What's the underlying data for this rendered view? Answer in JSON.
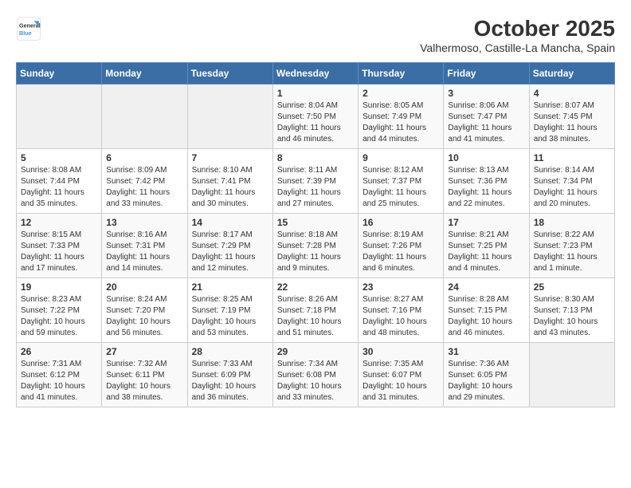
{
  "header": {
    "logo": {
      "general": "General",
      "blue": "Blue"
    },
    "title": "October 2025",
    "subtitle": "Valhermoso, Castille-La Mancha, Spain"
  },
  "weekdays": [
    "Sunday",
    "Monday",
    "Tuesday",
    "Wednesday",
    "Thursday",
    "Friday",
    "Saturday"
  ],
  "weeks": [
    [
      {
        "day": "",
        "info": ""
      },
      {
        "day": "",
        "info": ""
      },
      {
        "day": "",
        "info": ""
      },
      {
        "day": "1",
        "info": "Sunrise: 8:04 AM\nSunset: 7:50 PM\nDaylight: 11 hours and 46 minutes."
      },
      {
        "day": "2",
        "info": "Sunrise: 8:05 AM\nSunset: 7:49 PM\nDaylight: 11 hours and 44 minutes."
      },
      {
        "day": "3",
        "info": "Sunrise: 8:06 AM\nSunset: 7:47 PM\nDaylight: 11 hours and 41 minutes."
      },
      {
        "day": "4",
        "info": "Sunrise: 8:07 AM\nSunset: 7:45 PM\nDaylight: 11 hours and 38 minutes."
      }
    ],
    [
      {
        "day": "5",
        "info": "Sunrise: 8:08 AM\nSunset: 7:44 PM\nDaylight: 11 hours and 35 minutes."
      },
      {
        "day": "6",
        "info": "Sunrise: 8:09 AM\nSunset: 7:42 PM\nDaylight: 11 hours and 33 minutes."
      },
      {
        "day": "7",
        "info": "Sunrise: 8:10 AM\nSunset: 7:41 PM\nDaylight: 11 hours and 30 minutes."
      },
      {
        "day": "8",
        "info": "Sunrise: 8:11 AM\nSunset: 7:39 PM\nDaylight: 11 hours and 27 minutes."
      },
      {
        "day": "9",
        "info": "Sunrise: 8:12 AM\nSunset: 7:37 PM\nDaylight: 11 hours and 25 minutes."
      },
      {
        "day": "10",
        "info": "Sunrise: 8:13 AM\nSunset: 7:36 PM\nDaylight: 11 hours and 22 minutes."
      },
      {
        "day": "11",
        "info": "Sunrise: 8:14 AM\nSunset: 7:34 PM\nDaylight: 11 hours and 20 minutes."
      }
    ],
    [
      {
        "day": "12",
        "info": "Sunrise: 8:15 AM\nSunset: 7:33 PM\nDaylight: 11 hours and 17 minutes."
      },
      {
        "day": "13",
        "info": "Sunrise: 8:16 AM\nSunset: 7:31 PM\nDaylight: 11 hours and 14 minutes."
      },
      {
        "day": "14",
        "info": "Sunrise: 8:17 AM\nSunset: 7:29 PM\nDaylight: 11 hours and 12 minutes."
      },
      {
        "day": "15",
        "info": "Sunrise: 8:18 AM\nSunset: 7:28 PM\nDaylight: 11 hours and 9 minutes."
      },
      {
        "day": "16",
        "info": "Sunrise: 8:19 AM\nSunset: 7:26 PM\nDaylight: 11 hours and 6 minutes."
      },
      {
        "day": "17",
        "info": "Sunrise: 8:21 AM\nSunset: 7:25 PM\nDaylight: 11 hours and 4 minutes."
      },
      {
        "day": "18",
        "info": "Sunrise: 8:22 AM\nSunset: 7:23 PM\nDaylight: 11 hours and 1 minute."
      }
    ],
    [
      {
        "day": "19",
        "info": "Sunrise: 8:23 AM\nSunset: 7:22 PM\nDaylight: 10 hours and 59 minutes."
      },
      {
        "day": "20",
        "info": "Sunrise: 8:24 AM\nSunset: 7:20 PM\nDaylight: 10 hours and 56 minutes."
      },
      {
        "day": "21",
        "info": "Sunrise: 8:25 AM\nSunset: 7:19 PM\nDaylight: 10 hours and 53 minutes."
      },
      {
        "day": "22",
        "info": "Sunrise: 8:26 AM\nSunset: 7:18 PM\nDaylight: 10 hours and 51 minutes."
      },
      {
        "day": "23",
        "info": "Sunrise: 8:27 AM\nSunset: 7:16 PM\nDaylight: 10 hours and 48 minutes."
      },
      {
        "day": "24",
        "info": "Sunrise: 8:28 AM\nSunset: 7:15 PM\nDaylight: 10 hours and 46 minutes."
      },
      {
        "day": "25",
        "info": "Sunrise: 8:30 AM\nSunset: 7:13 PM\nDaylight: 10 hours and 43 minutes."
      }
    ],
    [
      {
        "day": "26",
        "info": "Sunrise: 7:31 AM\nSunset: 6:12 PM\nDaylight: 10 hours and 41 minutes."
      },
      {
        "day": "27",
        "info": "Sunrise: 7:32 AM\nSunset: 6:11 PM\nDaylight: 10 hours and 38 minutes."
      },
      {
        "day": "28",
        "info": "Sunrise: 7:33 AM\nSunset: 6:09 PM\nDaylight: 10 hours and 36 minutes."
      },
      {
        "day": "29",
        "info": "Sunrise: 7:34 AM\nSunset: 6:08 PM\nDaylight: 10 hours and 33 minutes."
      },
      {
        "day": "30",
        "info": "Sunrise: 7:35 AM\nSunset: 6:07 PM\nDaylight: 10 hours and 31 minutes."
      },
      {
        "day": "31",
        "info": "Sunrise: 7:36 AM\nSunset: 6:05 PM\nDaylight: 10 hours and 29 minutes."
      },
      {
        "day": "",
        "info": ""
      }
    ]
  ]
}
